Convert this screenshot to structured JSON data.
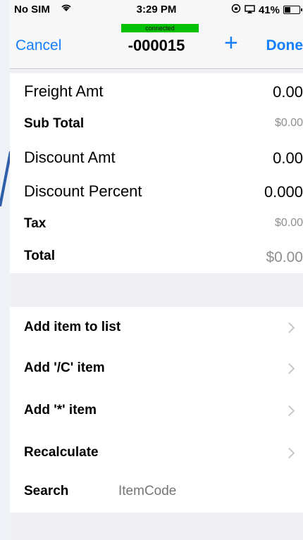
{
  "status": {
    "carrier": "No SIM",
    "time": "3:29 PM",
    "battery": "41%",
    "battery_fraction": 0.41
  },
  "nav": {
    "connection": "connected",
    "cancel": "Cancel",
    "title": "-000015",
    "add": "+",
    "done": "Done"
  },
  "totals": [
    {
      "label": "Freight Amt",
      "value": "0.00"
    },
    {
      "label": "Sub Total",
      "value": "$0.00"
    },
    {
      "label": "Discount Amt",
      "value": "0.00"
    },
    {
      "label": "Discount Percent",
      "value": "0.000"
    },
    {
      "label": "Tax",
      "value": "$0.00"
    },
    {
      "label": "Total",
      "value": "$0.00"
    }
  ],
  "actions": [
    {
      "label": "Add item to list"
    },
    {
      "label": "Add '/C' item"
    },
    {
      "label": "Add '*' item"
    },
    {
      "label": "Recalculate"
    }
  ],
  "search": {
    "label": "Search",
    "placeholder": "ItemCode"
  },
  "colors": {
    "accent": "#147efb",
    "connected": "#00c000"
  }
}
